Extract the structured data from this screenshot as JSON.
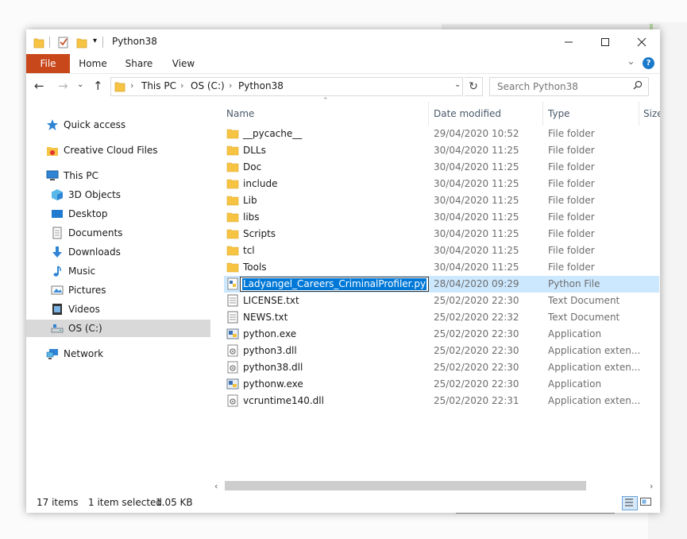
{
  "window": {
    "title": "Python38"
  },
  "ribbon": {
    "tabs": [
      "File",
      "Home",
      "Share",
      "View"
    ]
  },
  "address": {
    "segments": [
      "This PC",
      "OS (C:)",
      "Python38"
    ],
    "search_placeholder": "Search Python38"
  },
  "nav": {
    "items": [
      {
        "label": "Quick access",
        "icon": "star-icon"
      },
      {
        "label": "Creative Cloud Files",
        "icon": "creative-cloud-icon"
      },
      {
        "label": "This PC",
        "icon": "computer-icon"
      },
      {
        "label": "3D Objects",
        "icon": "cube-icon"
      },
      {
        "label": "Desktop",
        "icon": "desktop-icon"
      },
      {
        "label": "Documents",
        "icon": "documents-icon"
      },
      {
        "label": "Downloads",
        "icon": "download-icon"
      },
      {
        "label": "Music",
        "icon": "music-icon"
      },
      {
        "label": "Pictures",
        "icon": "pictures-icon"
      },
      {
        "label": "Videos",
        "icon": "videos-icon"
      },
      {
        "label": "OS (C:)",
        "icon": "drive-icon"
      },
      {
        "label": "Network",
        "icon": "network-icon"
      }
    ]
  },
  "columns": {
    "name": "Name",
    "date": "Date modified",
    "type": "Type",
    "size": "Size"
  },
  "files": [
    {
      "name": "__pycache__",
      "date": "29/04/2020 10:52",
      "type": "File folder",
      "icon": "folder-icon"
    },
    {
      "name": "DLLs",
      "date": "30/04/2020 11:25",
      "type": "File folder",
      "icon": "folder-icon"
    },
    {
      "name": "Doc",
      "date": "30/04/2020 11:25",
      "type": "File folder",
      "icon": "folder-icon"
    },
    {
      "name": "include",
      "date": "30/04/2020 11:25",
      "type": "File folder",
      "icon": "folder-icon"
    },
    {
      "name": "Lib",
      "date": "30/04/2020 11:25",
      "type": "File folder",
      "icon": "folder-icon"
    },
    {
      "name": "libs",
      "date": "30/04/2020 11:25",
      "type": "File folder",
      "icon": "folder-icon"
    },
    {
      "name": "Scripts",
      "date": "30/04/2020 11:25",
      "type": "File folder",
      "icon": "folder-icon"
    },
    {
      "name": "tcl",
      "date": "30/04/2020 11:25",
      "type": "File folder",
      "icon": "folder-icon"
    },
    {
      "name": "Tools",
      "date": "30/04/2020 11:25",
      "type": "File folder",
      "icon": "folder-icon"
    },
    {
      "name": "Ladyangel_Careers_CriminalProfiler.py",
      "date": "28/04/2020 09:29",
      "type": "Python File",
      "icon": "python-file-icon"
    },
    {
      "name": "LICENSE.txt",
      "date": "25/02/2020 22:30",
      "type": "Text Document",
      "icon": "text-file-icon"
    },
    {
      "name": "NEWS.txt",
      "date": "25/02/2020 22:32",
      "type": "Text Document",
      "icon": "text-file-icon"
    },
    {
      "name": "python.exe",
      "date": "25/02/2020 22:30",
      "type": "Application",
      "icon": "python-exe-icon"
    },
    {
      "name": "python3.dll",
      "date": "25/02/2020 22:30",
      "type": "Application exten...",
      "icon": "dll-icon"
    },
    {
      "name": "python38.dll",
      "date": "25/02/2020 22:30",
      "type": "Application exten...",
      "icon": "dll-icon"
    },
    {
      "name": "pythonw.exe",
      "date": "25/02/2020 22:30",
      "type": "Application",
      "icon": "python-exe-icon"
    },
    {
      "name": "vcruntime140.dll",
      "date": "25/02/2020 22:31",
      "type": "Application exten...",
      "icon": "dll-icon"
    }
  ],
  "status": {
    "items": "17 items",
    "selected": "1 item selected",
    "size": "1.05 KB"
  },
  "colors": {
    "file_tab": "#c8481c",
    "selection": "#cce8ff",
    "highlight": "#0078d7",
    "folder": "#f6c342"
  }
}
